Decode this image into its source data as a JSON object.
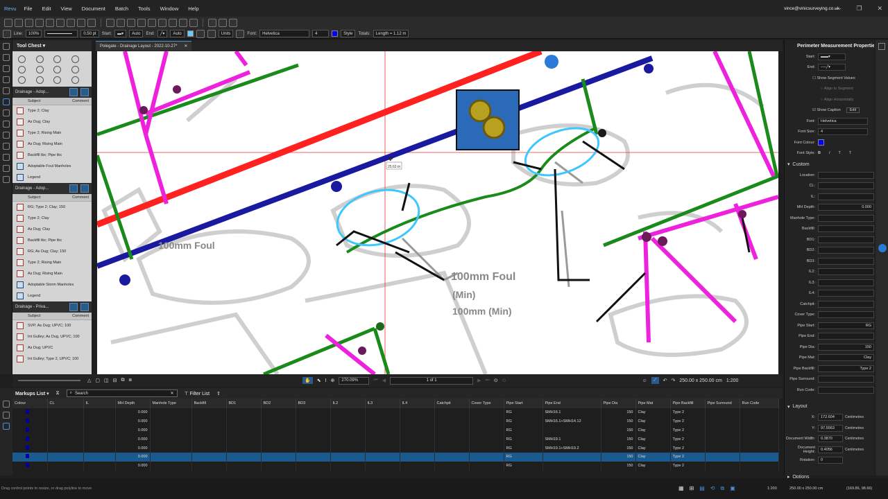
{
  "menu": {
    "logo": "Revu",
    "items": [
      "File",
      "Edit",
      "View",
      "Document",
      "Batch",
      "Tools",
      "Window",
      "Help"
    ],
    "user": "vince@vinicsurveying.co.uk"
  },
  "props_bar": {
    "line": "Line:",
    "opacity": "100%",
    "width": "0.50 pt",
    "start_label": "Start:",
    "start_auto": "Auto",
    "end_label": "End:",
    "end_auto": "Auto",
    "units": "Units",
    "font_label": "Font:",
    "font": "Helvetica",
    "font_size": "4",
    "style": "Style",
    "totals_label": "Totals:",
    "totals": "Length = 1.12 m",
    "line_color": "#6ec6ff",
    "font_color": "#0000ff"
  },
  "tool_chest": {
    "title": "Tool Chest",
    "col_subject": "Subject",
    "col_comment": "Comment",
    "sections": [
      {
        "title": "Drainage - Adop...",
        "items": [
          "Type 2; Clay",
          "As Dug; Clay",
          "Type 2; Rising Main",
          "As Dug; Rising Main",
          "Backfill tbc; Pipe tbc",
          "Adoptable Foul Manholes",
          "Legend"
        ]
      },
      {
        "title": "Drainage - Adop...",
        "items": [
          "RG; Type 2; Clay; 150",
          "Type 2; Clay",
          "As Dug; Clay",
          "Backfill tbc; Pipe tbc",
          "RG; As Dug; Clay; 150",
          "Type 2; Rising Main",
          "As Dug; Rising Main",
          "Adoptable Storm Manholes",
          "Legend"
        ]
      },
      {
        "title": "Drainage - Priva...",
        "items": [
          "SVP; As Dug; UPVC; 100",
          "Int Gulley; As Dug, UPVC; 100",
          "As Dug; UPVC",
          "Int Gulley; Type 2, UPVC; 100"
        ]
      }
    ]
  },
  "document_tab": {
    "title": "Polegate - Drainage Layout - 2022-10-27*"
  },
  "canvas": {
    "measure_label": "25.63 m",
    "text_block": [
      "100mm Foul",
      "(Min)",
      "100mm (Min)"
    ]
  },
  "nav": {
    "zoom": "270.09%",
    "page": "1 of 1",
    "size": "250.00 x 250.00 cm",
    "scale": "1:200"
  },
  "properties": {
    "title": "Perimeter Measurement Properties",
    "start": "Start:",
    "end": "End:",
    "show_segment_values": "Show Segment Values",
    "align_to_segment": "Align to Segment",
    "align_horizontally": "Align Horizontally",
    "show_caption": "Show Caption",
    "edit": "Edit",
    "font_label": "Font:",
    "font": "Helvetica",
    "font_size_label": "Font Size:",
    "font_size": "4",
    "font_colour_label": "Font Colour:",
    "font_style_label": "Font Style:",
    "custom_title": "Custom",
    "fields": [
      {
        "k": "Location:",
        "v": ""
      },
      {
        "k": "CL:",
        "v": ""
      },
      {
        "k": "IL:",
        "v": ""
      },
      {
        "k": "MH Depth:",
        "v": "0.000"
      },
      {
        "k": "Manhole Type:",
        "v": ""
      },
      {
        "k": "Backfill:",
        "v": ""
      },
      {
        "k": "BD1:",
        "v": ""
      },
      {
        "k": "BD2:",
        "v": ""
      },
      {
        "k": "BD3:",
        "v": ""
      },
      {
        "k": "IL2:",
        "v": ""
      },
      {
        "k": "IL3:",
        "v": ""
      },
      {
        "k": "IL4:",
        "v": ""
      },
      {
        "k": "Catchpit:",
        "v": ""
      },
      {
        "k": "Cover Type:",
        "v": ""
      },
      {
        "k": "Pipe Start:",
        "v": "RG"
      },
      {
        "k": "Pipe End:",
        "v": ""
      },
      {
        "k": "Pipe Dia:",
        "v": "150"
      },
      {
        "k": "Pipe Mat:",
        "v": "Clay"
      },
      {
        "k": "Pipe Backfill:",
        "v": "Type 2"
      },
      {
        "k": "Pipe Surround:",
        "v": ""
      },
      {
        "k": "Run Code:",
        "v": ""
      }
    ],
    "layout_title": "Layout",
    "layout": [
      {
        "k": "X:",
        "v": "172.604",
        "u": "Centimetres"
      },
      {
        "k": "Y:",
        "v": "97.5563",
        "u": "Centimetres"
      },
      {
        "k": "Document Width:",
        "v": "0.3870",
        "u": "Centimetres"
      },
      {
        "k": "Document Height:",
        "v": "0.4056",
        "u": "Centimetres"
      },
      {
        "k": "Rotation:",
        "v": "0",
        "u": ""
      }
    ],
    "options_title": "Options"
  },
  "markups": {
    "title": "Markups List",
    "search": "Search",
    "filter": "Filter List",
    "columns": [
      "Colour",
      "CL",
      "IL",
      "MH Depth",
      "Manhole Type",
      "Backfill",
      "BD1",
      "BD2",
      "BD3",
      "IL2",
      "IL3",
      "IL4",
      "Catchpit",
      "Cover Type",
      "Pipe Start",
      "Pipe End",
      "Pipe Dia",
      "Pipe Mat",
      "Pipe Backfill",
      "Pipe Surround",
      "Run Code"
    ],
    "rows": [
      {
        "mh": "0.000",
        "start": "RG",
        "end": "SMH16.1",
        "dia": "150",
        "mat": "Clay",
        "bf": "Type 2"
      },
      {
        "mh": "0.000",
        "start": "RG",
        "end": "SMH16.1+SMH14.12",
        "dia": "150",
        "mat": "Clay",
        "bf": "Type 2"
      },
      {
        "mh": "0.000",
        "start": "RG",
        "end": "",
        "dia": "150",
        "mat": "Clay",
        "bf": "Type 2"
      },
      {
        "mh": "0.000",
        "start": "RG",
        "end": "SMH19.1",
        "dia": "150",
        "mat": "Clay",
        "bf": "Type 2"
      },
      {
        "mh": "0.000",
        "start": "RG",
        "end": "SMH19.1+SMH19.2",
        "dia": "150",
        "mat": "Clay",
        "bf": "Type 2"
      },
      {
        "mh": "0.000",
        "start": "RG",
        "end": "",
        "dia": "150",
        "mat": "Clay",
        "bf": "Type 2"
      },
      {
        "mh": "0.000",
        "start": "RG",
        "end": "",
        "dia": "150",
        "mat": "Clay",
        "bf": "Type 2"
      }
    ],
    "selected_row": 5
  },
  "status": {
    "hint": "Drag control points to resize, or drag polyline to move",
    "scale": "1:200",
    "size": "250.00 x 250.00 cm",
    "coords": "(169.86, 98.66)"
  }
}
